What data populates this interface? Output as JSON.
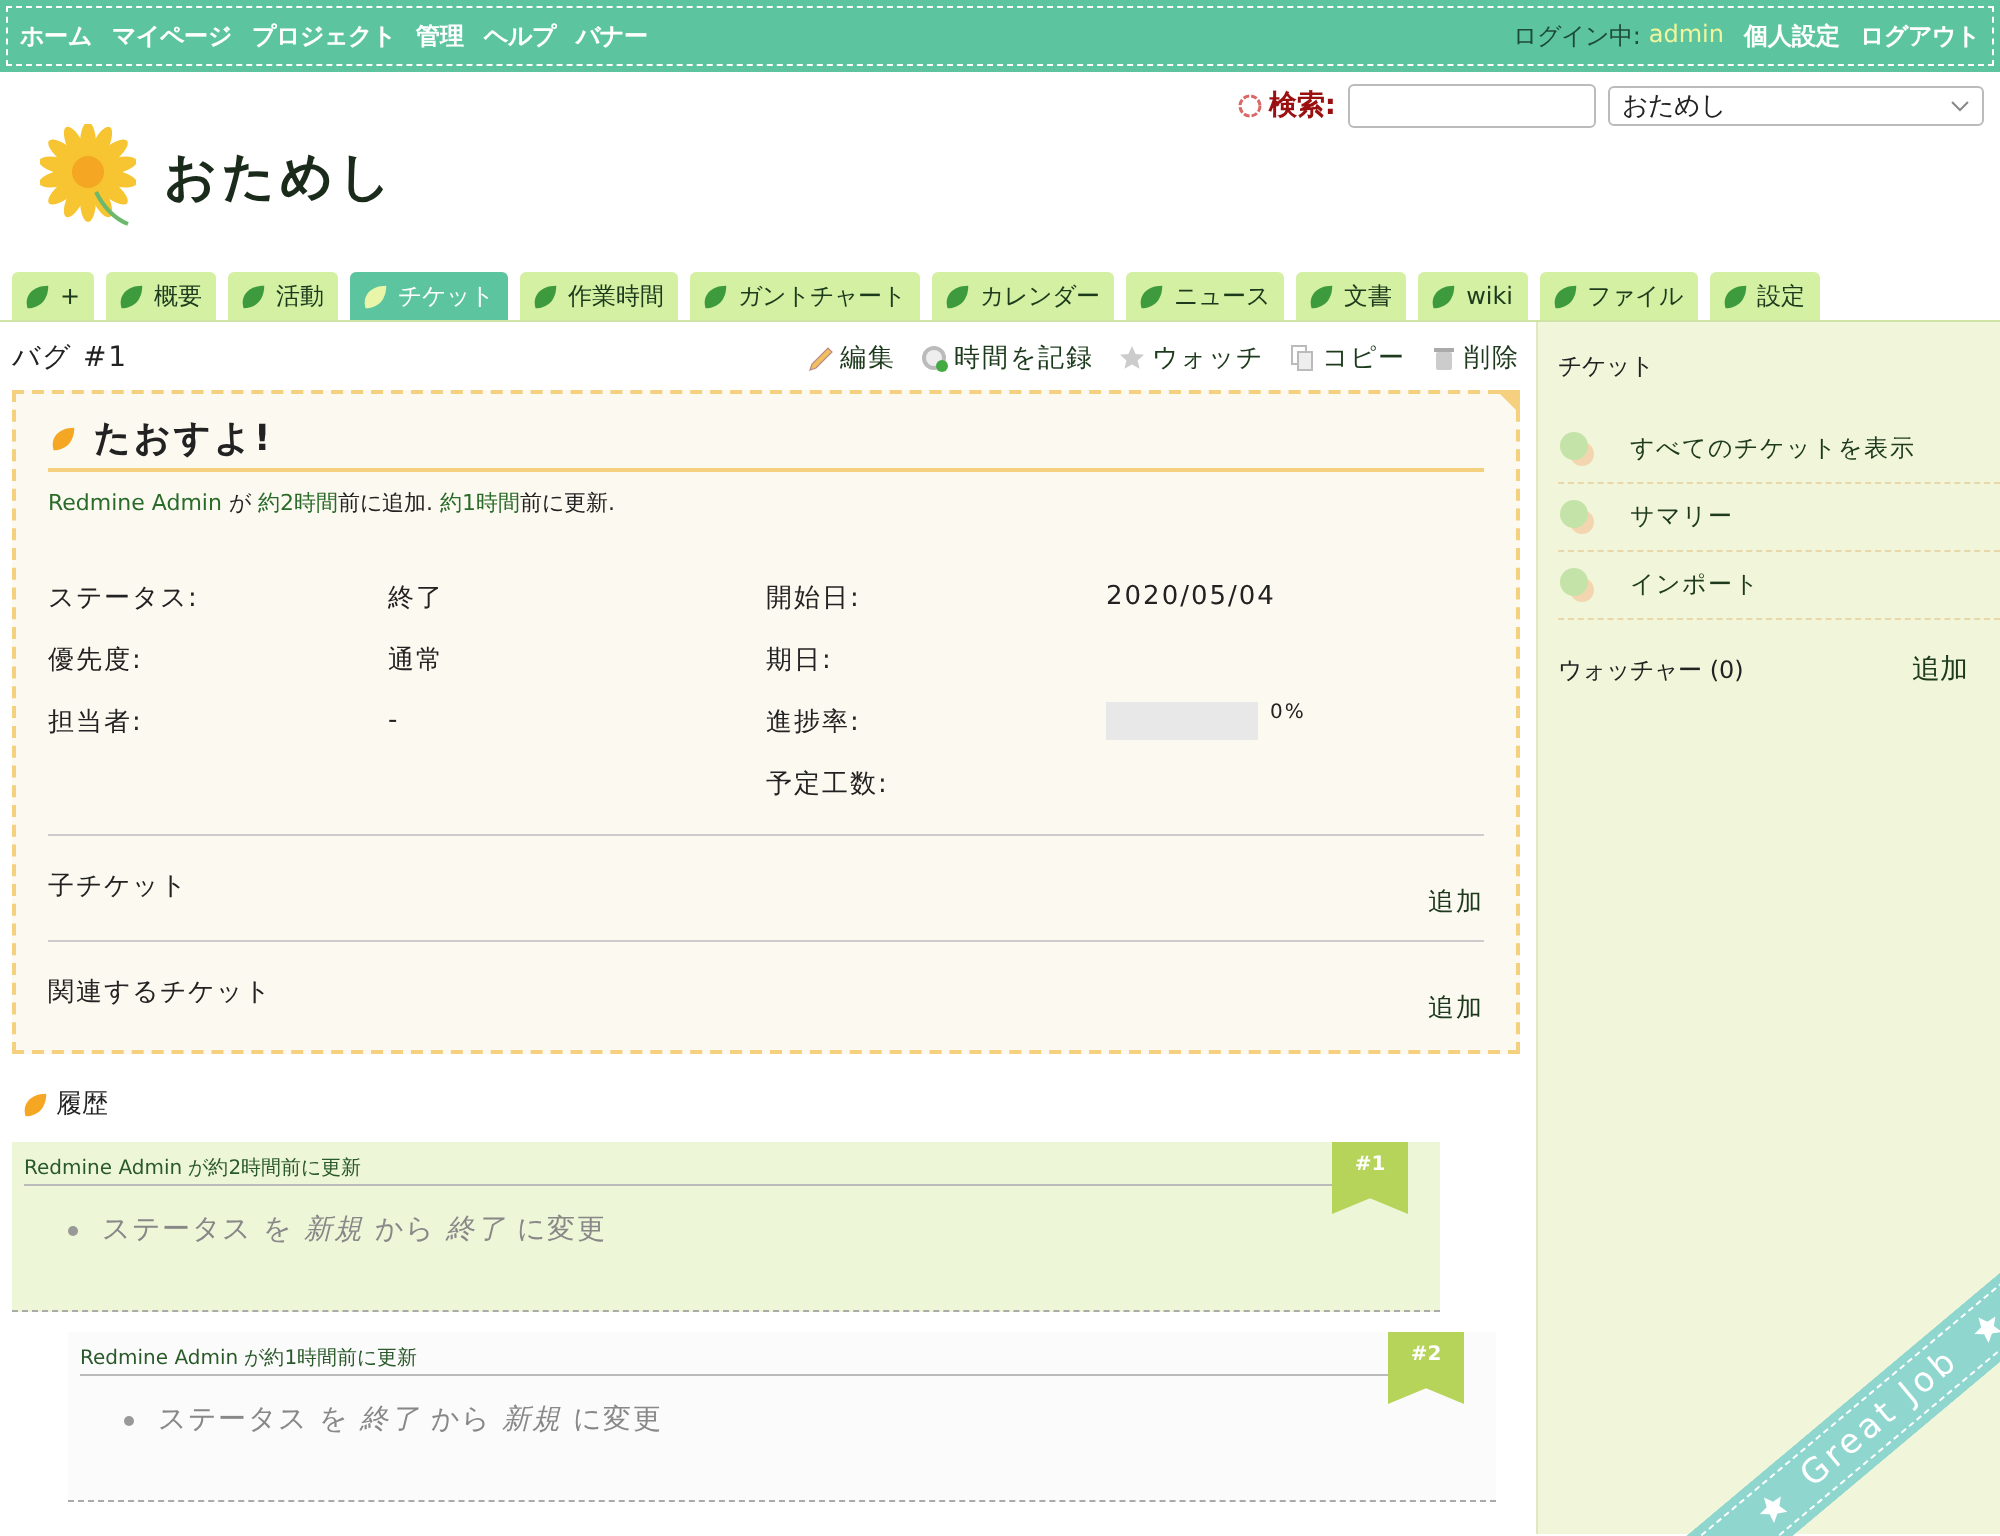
{
  "top_menu": {
    "items": [
      "ホーム",
      "マイページ",
      "プロジェクト",
      "管理",
      "ヘルプ",
      "バナー"
    ],
    "login_label": "ログイン中:",
    "user": "admin",
    "account_items": [
      "個人設定",
      "ログアウト"
    ]
  },
  "header": {
    "search_label": "検索:",
    "project_jump": "おためし",
    "title": "おためし"
  },
  "tabs": [
    {
      "label": "+",
      "selected": false
    },
    {
      "label": "概要",
      "selected": false
    },
    {
      "label": "活動",
      "selected": false
    },
    {
      "label": "チケット",
      "selected": true
    },
    {
      "label": "作業時間",
      "selected": false
    },
    {
      "label": "ガントチャート",
      "selected": false
    },
    {
      "label": "カレンダー",
      "selected": false
    },
    {
      "label": "ニュース",
      "selected": false
    },
    {
      "label": "文書",
      "selected": false
    },
    {
      "label": "wiki",
      "selected": false
    },
    {
      "label": "ファイル",
      "selected": false
    },
    {
      "label": "設定",
      "selected": false
    }
  ],
  "issue": {
    "title": "バグ #1",
    "actions": [
      {
        "kind": "edit",
        "label": "編集"
      },
      {
        "kind": "time",
        "label": "時間を記録"
      },
      {
        "kind": "watch",
        "label": "ウォッチ"
      },
      {
        "kind": "copy",
        "label": "コピー"
      },
      {
        "kind": "delete",
        "label": "削除"
      }
    ],
    "subject": "たおすよ!",
    "author_line": [
      {
        "text": "Redmine Admin",
        "link": true
      },
      {
        "text": " が ",
        "link": false
      },
      {
        "text": "約2時間",
        "link": true
      },
      {
        "text": "前に追加. ",
        "link": false
      },
      {
        "text": "約1時間",
        "link": true
      },
      {
        "text": "前に更新.",
        "link": false
      }
    ],
    "attributes_left": [
      {
        "kind": "text",
        "label": "ステータス:",
        "value": "終了"
      },
      {
        "kind": "text",
        "label": "優先度:",
        "value": "通常"
      },
      {
        "kind": "text",
        "label": "担当者:",
        "value": "-"
      }
    ],
    "attributes_right": [
      {
        "kind": "text",
        "label": "開始日:",
        "value": "2020/05/04"
      },
      {
        "kind": "text",
        "label": "期日:"
      },
      {
        "kind": "progress",
        "label": "進捗率:",
        "level": 0,
        "reading": "0%"
      },
      {
        "kind": "text",
        "label": "予定工数:"
      }
    ],
    "sections": [
      {
        "title": "子チケット",
        "action": "追加"
      },
      {
        "title": "関連するチケット",
        "action": "追加"
      }
    ]
  },
  "history": {
    "title": "履歴",
    "journals": [
      {
        "header": "Redmine Admin が約2時間前に更新",
        "number": "#1",
        "details": [
          "ステータス を *新規* から *終了* に変更"
        ]
      },
      {
        "header": "Redmine Admin が約1時間前に更新",
        "number": "#2",
        "details": [
          "ステータス を *終了* から *新規* に変更"
        ]
      }
    ]
  },
  "sidebar": {
    "title": "チケット",
    "links": [
      "すべてのチケットを表示",
      "サマリー",
      "インポート"
    ],
    "watchers_label": "ウォッチャー (0)",
    "watchers_action": "追加"
  },
  "ribbon": {
    "text": "Great Job"
  }
}
